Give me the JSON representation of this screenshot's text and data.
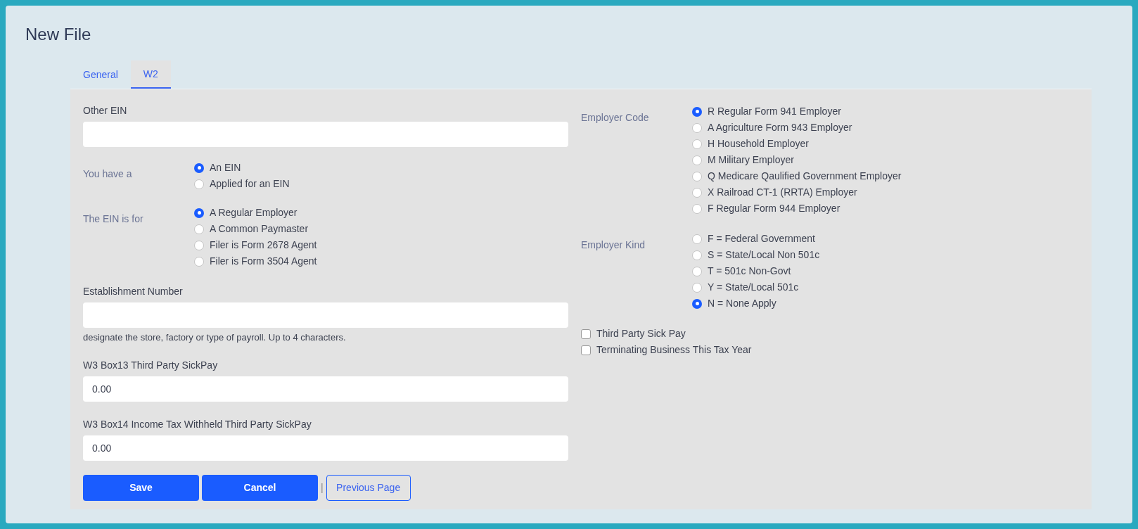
{
  "title": "New File",
  "tabs": [
    {
      "label": "General",
      "selected": false
    },
    {
      "label": "W2",
      "selected": true
    }
  ],
  "other_ein": {
    "label": "Other EIN"
  },
  "you_have": {
    "label": "You have a",
    "options": [
      {
        "label": "An EIN",
        "selected": true
      },
      {
        "label": "Applied for an EIN",
        "selected": false
      }
    ]
  },
  "ein_for": {
    "label": "The EIN is for",
    "options": [
      {
        "label": "A Regular Employer",
        "selected": true
      },
      {
        "label": "A Common Paymaster",
        "selected": false
      },
      {
        "label": "Filer is Form 2678 Agent",
        "selected": false
      },
      {
        "label": "Filer is Form 3504 Agent",
        "selected": false
      }
    ]
  },
  "establishment": {
    "label": "Establishment Number",
    "help": "designate the store, factory or type of payroll. Up to 4 characters."
  },
  "box13": {
    "label": "W3 Box13 Third Party SickPay",
    "value": "0.00"
  },
  "box14": {
    "label": "W3 Box14 Income Tax Withheld Third Party SickPay",
    "value": "0.00"
  },
  "employer_code": {
    "label": "Employer Code",
    "options": [
      {
        "label": "R Regular Form 941 Employer",
        "selected": true
      },
      {
        "label": "A Agriculture Form 943 Employer",
        "selected": false
      },
      {
        "label": "H Household Employer",
        "selected": false
      },
      {
        "label": "M Military Employer",
        "selected": false
      },
      {
        "label": "Q Medicare Qaulified Government Employer",
        "selected": false
      },
      {
        "label": "X Railroad CT-1 (RRTA) Employer",
        "selected": false
      },
      {
        "label": "F Regular Form 944 Employer",
        "selected": false
      }
    ]
  },
  "employer_kind": {
    "label": "Employer Kind",
    "options": [
      {
        "label": "F = Federal Government",
        "selected": false
      },
      {
        "label": "S = State/Local Non 501c",
        "selected": false
      },
      {
        "label": "T = 501c Non-Govt",
        "selected": false
      },
      {
        "label": "Y = State/Local 501c",
        "selected": false
      },
      {
        "label": "N = None Apply",
        "selected": true
      }
    ]
  },
  "checkboxes": [
    {
      "label": "Third Party Sick Pay",
      "checked": false
    },
    {
      "label": "Terminating Business This Tax Year",
      "checked": false
    }
  ],
  "buttons": {
    "save": "Save",
    "cancel": "Cancel",
    "separator": "|",
    "previous": "Previous Page"
  }
}
